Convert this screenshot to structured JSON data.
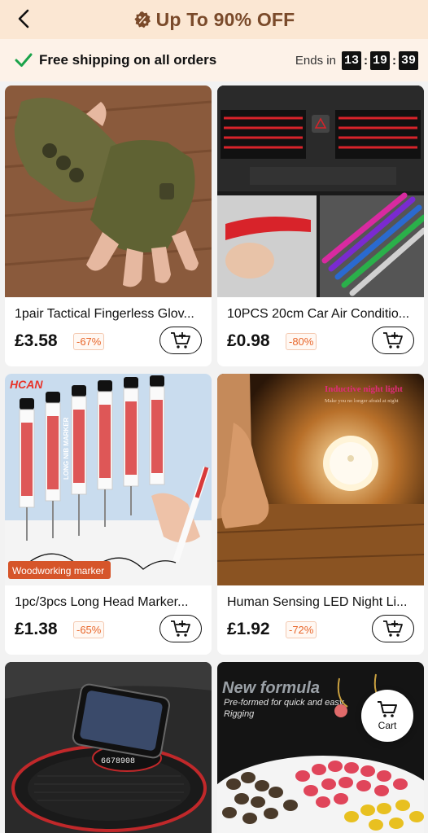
{
  "header": {
    "title": "Up To 90% OFF",
    "back_icon": "chevron-left-icon",
    "badge_icon": "percent-badge-icon"
  },
  "shipping_bar": {
    "text": "Free shipping on all orders",
    "ends_label": "Ends in",
    "timer": {
      "hours": "13",
      "minutes": "19",
      "seconds": "39"
    }
  },
  "products": [
    {
      "title": "1pair Tactical Fingerless Glov...",
      "price": "£3.58",
      "discount": "-67%"
    },
    {
      "title": "10PCS 20cm Car Air Conditio...",
      "price": "£0.98",
      "discount": "-80%"
    },
    {
      "title": "1pc/3pcs Long Head Marker...",
      "price": "£1.38",
      "discount": "-65%",
      "image_text": {
        "brand": "HCAN",
        "marker_label": "LONG NIB MARKER",
        "badge": "Woodworking marker"
      }
    },
    {
      "title": "Human Sensing LED Night Li...",
      "price": "£1.92",
      "discount": "-72%",
      "image_text": {
        "headline": "Inductive night light",
        "subline": "Make you no longer afraid at night"
      }
    },
    {
      "title": "",
      "price": "",
      "discount": "",
      "image_text": {
        "code": "6678908"
      }
    },
    {
      "title": "",
      "price": "",
      "discount": "",
      "image_text": {
        "headline": "New formula",
        "subline": "Pre-formed for quick and easy Rigging"
      }
    }
  ],
  "floating_cart": {
    "label": "Cart"
  },
  "colors": {
    "header_bg": "#fbe7d3",
    "accent_brown": "#7a4a2a",
    "discount": "#e8662a",
    "check_green": "#1aa34a"
  }
}
